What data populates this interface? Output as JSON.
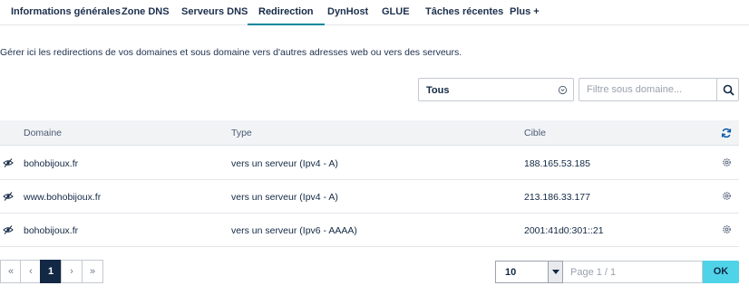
{
  "tabs": [
    {
      "label": "Informations générales",
      "active": false
    },
    {
      "label": "Zone DNS",
      "active": false
    },
    {
      "label": "Serveurs DNS",
      "active": false
    },
    {
      "label": "Redirection",
      "active": true
    },
    {
      "label": "DynHost",
      "active": false
    },
    {
      "label": "GLUE",
      "active": false
    },
    {
      "label": "Tâches récentes",
      "active": false
    },
    {
      "label": "Plus +",
      "active": false
    }
  ],
  "intro_text": "Gérer ici les redirections de vos domaines et sous domaine vers d'autres adresses web ou vers des serveurs.",
  "filters": {
    "type_select_value": "Tous",
    "subdomain_placeholder": "Filtre sous domaine..."
  },
  "table": {
    "columns": [
      "Domaine",
      "Type",
      "Cible"
    ],
    "rows": [
      {
        "domain": "bohobijoux.fr",
        "type": "vers un serveur (Ipv4 - A)",
        "target": "188.165.53.185"
      },
      {
        "domain": "www.bohobijoux.fr",
        "type": "vers un serveur (Ipv4 - A)",
        "target": "213.186.33.177"
      },
      {
        "domain": "bohobijoux.fr",
        "type": "vers un serveur (Ipv6 - AAAA)",
        "target": "2001:41d0:301::21"
      }
    ]
  },
  "pagination": {
    "first": "«",
    "prev": "‹",
    "current_page": "1",
    "next": "›",
    "last": "»",
    "per_page": "10",
    "page_placeholder": "Page 1 / 1",
    "ok_label": "OK"
  },
  "colors": {
    "accent": "#00889c",
    "primary_dark": "#122844",
    "ok_button": "#4fd3e8"
  }
}
